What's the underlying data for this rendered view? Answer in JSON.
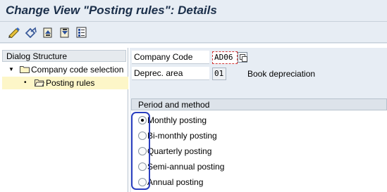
{
  "window": {
    "title": "Change View \"Posting rules\": Details"
  },
  "toolbar": {
    "buttons": [
      {
        "icon": "display-change-icon"
      },
      {
        "icon": "other-entry-icon"
      },
      {
        "icon": "previous-entry-icon"
      },
      {
        "icon": "next-entry-icon"
      },
      {
        "icon": "select-all-icon"
      }
    ]
  },
  "dialog_structure": {
    "header": "Dialog Structure",
    "items": [
      {
        "label": "Company code selection",
        "level": 0,
        "expanded": true,
        "selected": false
      },
      {
        "label": "Posting rules",
        "level": 1,
        "expanded": false,
        "selected": true
      }
    ]
  },
  "fields": {
    "company_code": {
      "label": "Company Code",
      "value": "AD06"
    },
    "deprec_area": {
      "label": "Deprec. area",
      "value": "01",
      "description": "Book depreciation"
    }
  },
  "period_method": {
    "header": "Period and method",
    "options": [
      {
        "label": "Monthly posting",
        "selected": true
      },
      {
        "label": "Bi-monthly posting",
        "selected": false
      },
      {
        "label": "Quarterly posting",
        "selected": false
      },
      {
        "label": "Semi-annual posting",
        "selected": false
      },
      {
        "label": "Annual posting",
        "selected": false
      }
    ]
  },
  "colors": {
    "highlight": "#2b3fbf",
    "required_border": "#d23a3a",
    "selection": "#fdf6c8"
  }
}
